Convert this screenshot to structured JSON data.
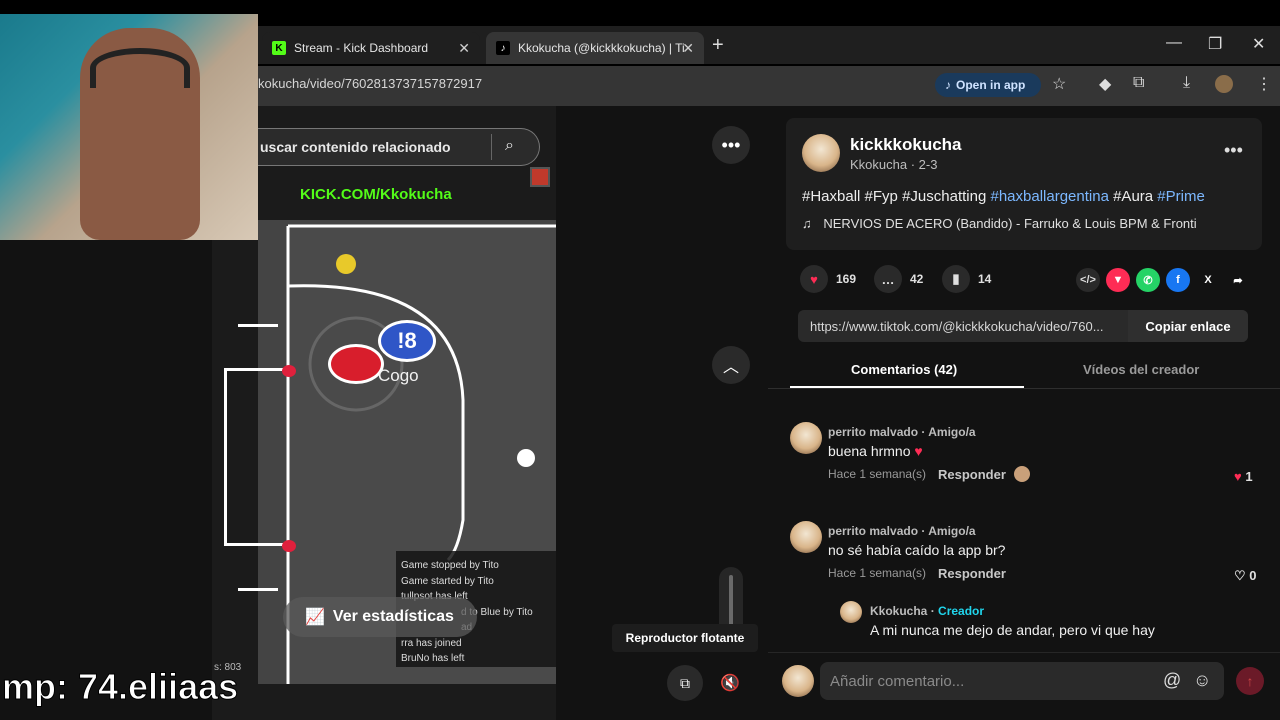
{
  "browser": {
    "tabs": [
      {
        "title": "Stream - Kick Dashboard",
        "icon": "kick-icon"
      },
      {
        "title": "Kkokucha (@kickkkokucha) | Ti",
        "icon": "tiktok-icon"
      }
    ],
    "url": "kokucha/video/7602813737157872917",
    "open_in_app": "Open in app"
  },
  "video": {
    "search_placeholder": "uscar contenido relacionado",
    "kick_url": "KICK.COM/Kkokucha",
    "player_label": "!8",
    "player_name": "Cogo",
    "stats_button": "Ver estadísticas",
    "game_log": [
      "Game stopped by Tito",
      "Game started by Tito",
      "tullpsot has left",
      "d to Blue by Tito",
      "ad",
      "rra has joined",
      "BruNo has left"
    ],
    "corner_counter": "s: 803",
    "tooltip": "Reproductor flotante"
  },
  "overlay_text": "mp: 74.eliiaas",
  "post": {
    "author": "kickkkokucha",
    "author_sub": "Kkokucha · 2-3",
    "caption_plain": [
      "#Haxball",
      "#Fyp",
      "#Juschatting"
    ],
    "caption_links": [
      "#haxballargentina",
      "#Aura",
      "#Prime"
    ],
    "music": "NERVIOS DE ACERO (Bandido) - Farruko & Louis BPM & Fronti",
    "likes": "169",
    "comments": "42",
    "saves": "14",
    "link": "https://www.tiktok.com/@kickkkokucha/video/760...",
    "copy_link": "Copiar enlace",
    "tab_comments": "Comentarios (42)",
    "tab_creator": "Vídeos del creador"
  },
  "comments": [
    {
      "user": "perrito malvado",
      "badge": "Amigo/a",
      "text": "buena hrmno",
      "time": "Hace 1 semana(s)",
      "reply": "Responder",
      "likes": "1",
      "liked": true
    },
    {
      "user": "perrito malvado",
      "badge": "Amigo/a",
      "text": "no sé había caído la app br?",
      "time": "Hace 1 semana(s)",
      "reply": "Responder",
      "likes": "0",
      "liked": false
    },
    {
      "user": "Kkokucha",
      "badge": "Creador",
      "text": "A mi nunca me dejo de andar, pero vi que hay"
    }
  ],
  "compose_placeholder": "Añadir comentario...",
  "colors": {
    "kick_green": "#53fc18",
    "tiktok_red": "#fe2c55",
    "link_blue": "#7cb8ff",
    "creator_teal": "#20d5ec"
  }
}
